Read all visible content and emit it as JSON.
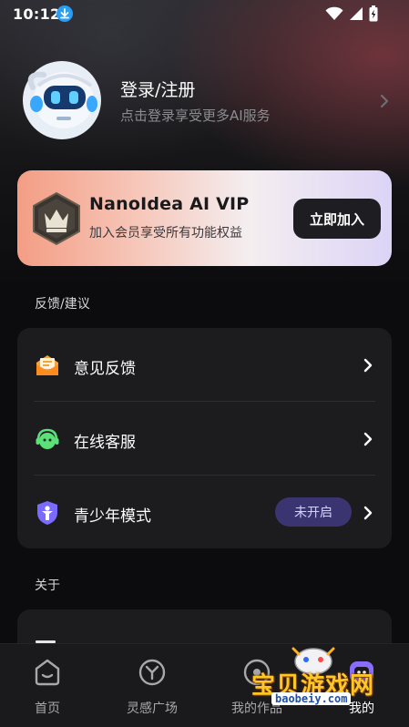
{
  "status_bar": {
    "time": "10:12",
    "icons": [
      "download-icon",
      "wifi-icon",
      "signal-icon",
      "battery-charging-icon"
    ]
  },
  "profile": {
    "title": "登录/注册",
    "subtitle": "点击登录享受更多AI服务",
    "avatar_icon": "robot-avatar-icon"
  },
  "vip": {
    "title": "NanoIdea AI VIP",
    "description": "加入会员享受所有功能权益",
    "join_label": "立即加入",
    "badge_icon": "crown-badge-icon"
  },
  "feedback_section": {
    "label": "反馈/建议",
    "items": [
      {
        "label": "意见反馈",
        "icon": "mail-icon"
      },
      {
        "label": "在线客服",
        "icon": "headset-icon"
      },
      {
        "label": "青少年模式",
        "icon": "shield-child-icon",
        "status": "未开启"
      }
    ]
  },
  "about_section": {
    "label": "关于"
  },
  "bottom_nav": {
    "items": [
      {
        "label": "首页",
        "icon": "home-icon"
      },
      {
        "label": "灵感广场",
        "icon": "inspiration-icon"
      },
      {
        "label": "我的作品",
        "icon": "works-icon"
      },
      {
        "label": "我的",
        "icon": "mine-icon"
      }
    ]
  },
  "watermark": {
    "text": "宝贝游戏网",
    "url": "baobeiy.com"
  },
  "colors": {
    "background": "#0c0c0e",
    "card": "#1c1c1f",
    "accent_pill": "#3a3570",
    "vip_gradient_start": "#f49d84",
    "vip_gradient_end": "#dcd4f6"
  }
}
